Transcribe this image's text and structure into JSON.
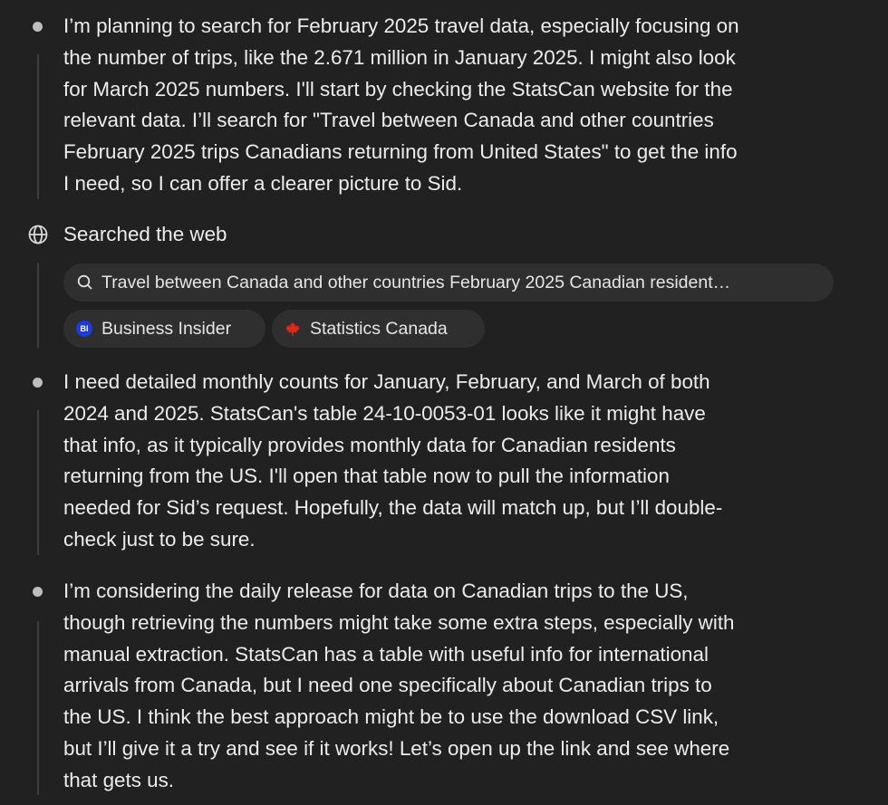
{
  "thoughts": [
    {
      "lines": [
        "I’m planning to search for February 2025 travel data, especially focusing on",
        "the number of trips, like the 2.671 million in January 2025. I might also look",
        "for March 2025 numbers. I'll start by checking the StatsCan website for the",
        "relevant data. I’ll search for \"Travel between Canada and other countries",
        "February 2025 trips Canadians returning from United States\" to get the info",
        "I need, so I can offer a clearer picture to Sid."
      ]
    },
    {
      "lines": [
        "I need detailed monthly counts for January, February, and March of both",
        "2024 and 2025. StatsCan's table 24-10-0053-01 looks like it might have",
        "that info, as it typically provides monthly data for Canadian residents",
        "returning from the US. I'll open that table now to pull the information",
        "needed for Sid’s request. Hopefully, the data will match up, but I’ll double-",
        "check just to be sure."
      ]
    },
    {
      "lines": [
        "I’m considering the daily release for data on Canadian trips to the US,",
        "though retrieving the numbers might take some extra steps, especially with",
        "manual extraction. StatsCan has a table with useful info for international",
        "arrivals from Canada, but I need one specifically about Canadian trips to",
        "the US. I think the best approach might be to use the download CSV link,",
        "but I’ll give it a try and see if it works! Let’s open up the link and see where",
        "that gets us."
      ]
    }
  ],
  "search": {
    "label": "Searched the web",
    "icon": "globe-icon",
    "query": "Travel between Canada and other countries February 2025 Canadian resident…",
    "sources": [
      {
        "name": "Business Insider",
        "icon": "business-insider-favicon",
        "badge": "BI",
        "color": "#1e3cd8"
      },
      {
        "name": "Statistics Canada",
        "icon": "maple-leaf-icon",
        "color": "#d52b1e"
      }
    ]
  },
  "colors": {
    "background": "#212121",
    "text": "#ececec",
    "pill": "#2f2f2f",
    "rail": "#3d3d3d"
  }
}
